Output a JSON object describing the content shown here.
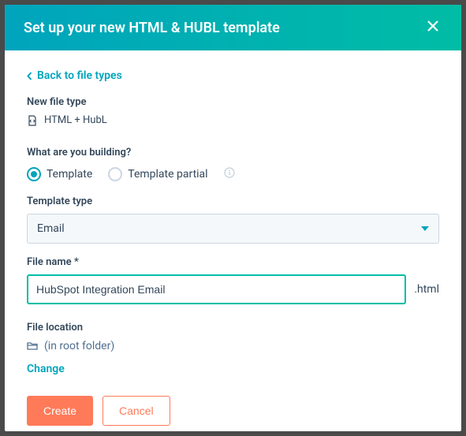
{
  "header": {
    "title": "Set up your new HTML & HUBL template"
  },
  "back_link": "Back to file types",
  "labels": {
    "new_file_type": "New file type",
    "file_type_value": "HTML + HubL",
    "building_q": "What are you building?",
    "template_type": "Template type",
    "file_name": "File name *",
    "file_location": "File location",
    "extension": ".html"
  },
  "radios": {
    "template": "Template",
    "partial": "Template partial"
  },
  "select": {
    "value": "Email"
  },
  "filename": {
    "value": "HubSpot Integration Email"
  },
  "location": {
    "value": "(in root folder)",
    "change": "Change"
  },
  "buttons": {
    "create": "Create",
    "cancel": "Cancel"
  }
}
